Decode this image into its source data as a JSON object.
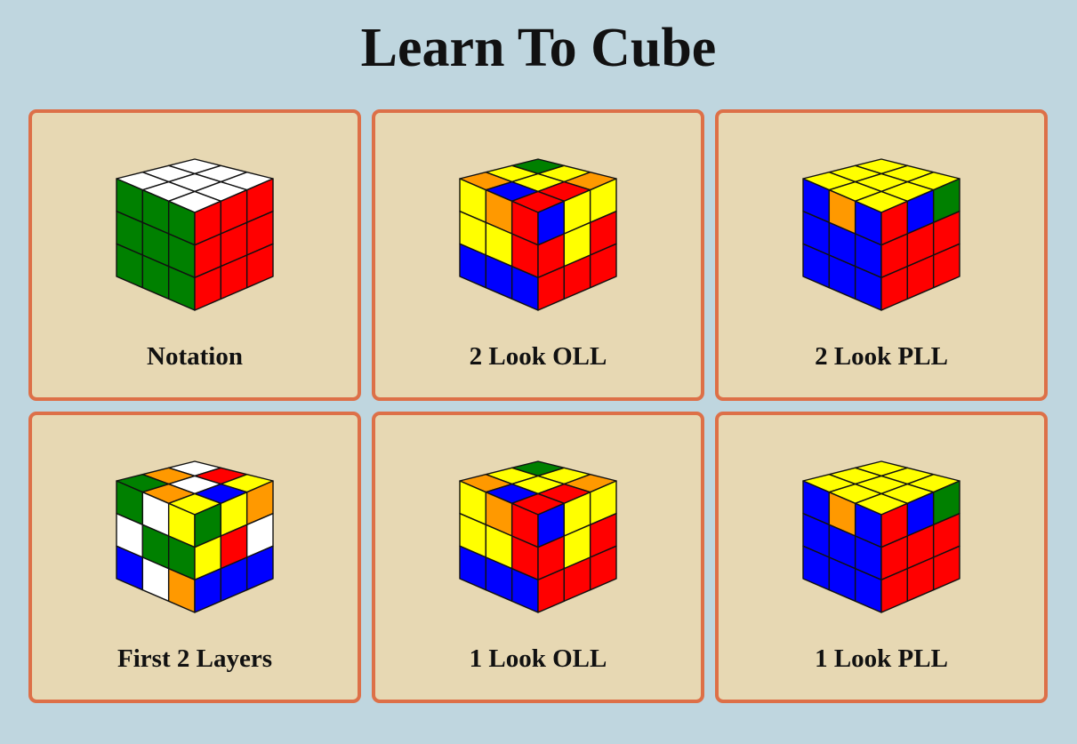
{
  "page": {
    "title": "Learn To Cube"
  },
  "colors": {
    "background": "#bfd6df",
    "card_fill": "#e7d8b3",
    "card_border": "#dd7048",
    "W": "#ffffff",
    "Y": "#ffff00",
    "R": "#ff0000",
    "O": "#ff9900",
    "G": "#008000",
    "B": "#0000ff"
  },
  "cards": [
    {
      "label": "Notation",
      "icon": "solved-cube-icon",
      "top": [
        "W",
        "W",
        "W",
        "W",
        "W",
        "W",
        "W",
        "W",
        "W"
      ],
      "left": [
        "G",
        "G",
        "G",
        "G",
        "G",
        "G",
        "G",
        "G",
        "G"
      ],
      "right": [
        "R",
        "R",
        "R",
        "R",
        "R",
        "R",
        "R",
        "R",
        "R"
      ]
    },
    {
      "label": "2 Look OLL",
      "icon": "oll-cube-icon",
      "top": [
        "G",
        "Y",
        "O",
        "Y",
        "Y",
        "R",
        "O",
        "B",
        "R"
      ],
      "left": [
        "Y",
        "O",
        "R",
        "Y",
        "Y",
        "R",
        "B",
        "B",
        "B"
      ],
      "right": [
        "B",
        "Y",
        "Y",
        "R",
        "Y",
        "R",
        "R",
        "R",
        "R"
      ]
    },
    {
      "label": "2 Look PLL",
      "icon": "pll-cube-icon",
      "top": [
        "Y",
        "Y",
        "Y",
        "Y",
        "Y",
        "Y",
        "Y",
        "Y",
        "Y"
      ],
      "left": [
        "B",
        "O",
        "B",
        "B",
        "B",
        "B",
        "B",
        "B",
        "B"
      ],
      "right": [
        "R",
        "B",
        "G",
        "R",
        "R",
        "R",
        "R",
        "R",
        "R"
      ]
    },
    {
      "label": "First 2 Layers",
      "icon": "f2l-cube-icon",
      "top": [
        "W",
        "R",
        "Y",
        "O",
        "W",
        "B",
        "G",
        "O",
        "Y"
      ],
      "left": [
        "G",
        "W",
        "Y",
        "W",
        "G",
        "G",
        "B",
        "W",
        "O"
      ],
      "right": [
        "G",
        "Y",
        "O",
        "Y",
        "R",
        "W",
        "B",
        "B",
        "B"
      ]
    },
    {
      "label": "1 Look OLL",
      "icon": "oll-cube-icon",
      "top": [
        "G",
        "Y",
        "O",
        "Y",
        "Y",
        "R",
        "O",
        "B",
        "R"
      ],
      "left": [
        "Y",
        "O",
        "R",
        "Y",
        "Y",
        "R",
        "B",
        "B",
        "B"
      ],
      "right": [
        "B",
        "Y",
        "Y",
        "R",
        "Y",
        "R",
        "R",
        "R",
        "R"
      ]
    },
    {
      "label": "1 Look PLL",
      "icon": "pll-cube-icon",
      "top": [
        "Y",
        "Y",
        "Y",
        "Y",
        "Y",
        "Y",
        "Y",
        "Y",
        "Y"
      ],
      "left": [
        "B",
        "O",
        "B",
        "B",
        "B",
        "B",
        "B",
        "B",
        "B"
      ],
      "right": [
        "R",
        "B",
        "G",
        "R",
        "R",
        "R",
        "R",
        "R",
        "R"
      ]
    }
  ]
}
